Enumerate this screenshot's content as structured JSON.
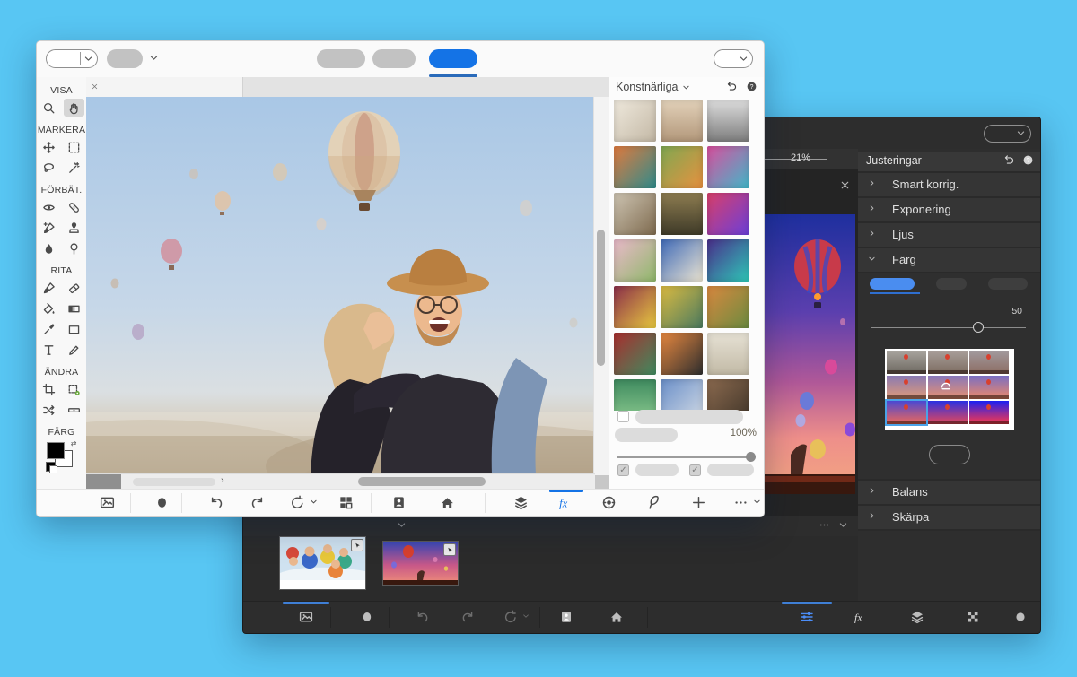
{
  "page": {
    "background_color": "#58c6f3",
    "accent_blue": "#1473e6",
    "dark_accent_blue": "#4b8df8"
  },
  "front_window": {
    "toolbar": {
      "left_controls": [
        {
          "name": "tool-preset-split-button"
        },
        {
          "name": "view-dropdown"
        }
      ],
      "mode_tabs": [
        {
          "name": "mode-tab-1",
          "active": false
        },
        {
          "name": "mode-tab-2",
          "active": false
        },
        {
          "name": "mode-tab-3",
          "active": true
        }
      ],
      "right_controls": [
        {
          "name": "open-dropdown"
        }
      ]
    },
    "sidebar": {
      "groups": [
        {
          "label": "VISA",
          "tools": [
            {
              "name": "zoom-tool",
              "icon": "zoom"
            },
            {
              "name": "hand-tool",
              "icon": "hand",
              "selected": true
            }
          ]
        },
        {
          "label": "MARKERA",
          "tools": [
            {
              "name": "move-tool",
              "icon": "move"
            },
            {
              "name": "marquee-tool",
              "icon": "marquee"
            },
            {
              "name": "lasso-tool",
              "icon": "lasso"
            },
            {
              "name": "magic-wand-tool",
              "icon": "magic-wand"
            }
          ]
        },
        {
          "label": "FÖRBÄT.",
          "tools": [
            {
              "name": "red-eye-tool",
              "icon": "red-eye"
            },
            {
              "name": "spot-heal-tool",
              "icon": "spot-heal"
            },
            {
              "name": "smart-brush-tool",
              "icon": "smart-brush"
            },
            {
              "name": "clone-stamp-tool",
              "icon": "clone-stamp"
            },
            {
              "name": "blur-tool",
              "icon": "blur"
            },
            {
              "name": "sponge-tool",
              "icon": "sponge"
            }
          ]
        },
        {
          "label": "RITA",
          "tools": [
            {
              "name": "brush-tool",
              "icon": "brush"
            },
            {
              "name": "eraser-tool",
              "icon": "eraser"
            },
            {
              "name": "paint-bucket-tool",
              "icon": "paint-bucket"
            },
            {
              "name": "gradient-tool",
              "icon": "gradient"
            },
            {
              "name": "eyedropper-tool",
              "icon": "eyedropper"
            },
            {
              "name": "shape-tool",
              "icon": "shape"
            },
            {
              "name": "type-tool",
              "icon": "type"
            },
            {
              "name": "pencil-tool",
              "icon": "pencil"
            }
          ]
        },
        {
          "label": "ÄNDRA",
          "tools": [
            {
              "name": "crop-tool",
              "icon": "crop"
            },
            {
              "name": "recompose-tool",
              "icon": "recompose"
            },
            {
              "name": "content-move-tool",
              "icon": "content-move"
            },
            {
              "name": "straighten-tool",
              "icon": "straighten"
            }
          ]
        },
        {
          "label": "FÄRG",
          "tools": [
            {
              "name": "color-swatches",
              "icon": "swatches"
            }
          ]
        }
      ]
    },
    "filters_panel": {
      "title": "Konstnärliga",
      "opacity_value": "100%",
      "thumbnails": [
        {
          "name": "portrait-sketch",
          "bg": "linear-gradient(135deg,#efe9dd,#c3b8a5)"
        },
        {
          "name": "taj-mahal-sepia",
          "bg": "linear-gradient(180deg,#e3d2ba,#b2977a)"
        },
        {
          "name": "city-mono",
          "bg": "linear-gradient(180deg,#dedede,#7d7d7d)"
        },
        {
          "name": "tropical-paint",
          "bg": "linear-gradient(135deg,#e07a3e,#2e8b8b)"
        },
        {
          "name": "gauguin-figures",
          "bg": "linear-gradient(135deg,#7fa851,#e8913f)"
        },
        {
          "name": "abstract-face",
          "bg": "linear-gradient(135deg,#d94f9e,#3fb8c9)"
        },
        {
          "name": "cubist-collage",
          "bg": "linear-gradient(135deg,#cdc4b2,#7e6a4e)"
        },
        {
          "name": "mona-lisa",
          "bg": "linear-gradient(180deg,#8d7c50,#3e3a28)"
        },
        {
          "name": "pop-portrait",
          "bg": "linear-gradient(135deg,#d93f6a,#6a3fd9)"
        },
        {
          "name": "pastel-village",
          "bg": "linear-gradient(135deg,#eab9ca,#8fb86a)"
        },
        {
          "name": "great-wave",
          "bg": "linear-gradient(135deg,#3f6ab8,#ece5d2)"
        },
        {
          "name": "abstract-teal",
          "bg": "linear-gradient(135deg,#4a2e8b,#2ec9b8)"
        },
        {
          "name": "pop-dog",
          "bg": "linear-gradient(135deg,#8b2e4a,#e8c93f)"
        },
        {
          "name": "van-gogh-portrait",
          "bg": "linear-gradient(135deg,#dcbb41,#4a7a5f)"
        },
        {
          "name": "olive-grove",
          "bg": "linear-gradient(135deg,#d9883f,#6a8b3f)"
        },
        {
          "name": "night-cafe",
          "bg": "linear-gradient(135deg,#a82e2e,#3f8b5f)"
        },
        {
          "name": "figure-abstract",
          "bg": "linear-gradient(135deg,#e8883f,#2e2e2e)"
        },
        {
          "name": "faint-sketch",
          "bg": "linear-gradient(180deg,#e6e1d4,#c2baa6)"
        },
        {
          "name": "green-feathers",
          "bg": "linear-gradient(180deg,#3f8b5f,#8bc98f)"
        },
        {
          "name": "starry-swirl",
          "bg": "linear-gradient(135deg,#6a8fc9,#d2dae4)"
        },
        {
          "name": "rustic-dark",
          "bg": "linear-gradient(135deg,#8b6a4f,#3f3428)"
        }
      ]
    },
    "bottombar": {
      "icons": [
        "photo-bin",
        "tool-options",
        "undo",
        "redo",
        "reset-rotate",
        "layout",
        "organizer",
        "home",
        "layers",
        "fx",
        "filters",
        "graphics",
        "add",
        "more"
      ],
      "active_icon": "fx"
    }
  },
  "back_window": {
    "zoom_value": "21%",
    "top_controls": [
      {
        "name": "open-dropdown"
      }
    ],
    "adjustments": {
      "title": "Justeringar",
      "sections": [
        {
          "label": "Smart korrig.",
          "expanded": false
        },
        {
          "label": "Exponering",
          "expanded": false
        },
        {
          "label": "Ljus",
          "expanded": false
        },
        {
          "label": "Färg",
          "expanded": true
        },
        {
          "label": "Balans",
          "expanded": false
        },
        {
          "label": "Skärpa",
          "expanded": false
        }
      ],
      "farg": {
        "tabs": [
          {
            "name": "farg-tab-1",
            "active": true
          },
          {
            "name": "farg-tab-2",
            "active": false
          },
          {
            "name": "farg-tab-3",
            "active": false
          }
        ],
        "value": "50",
        "selected_variation": 6,
        "overlay_variation": 4,
        "variations": [
          {
            "name": "variation-1",
            "bg": "linear-gradient(180deg,#a8a49e,#6c675f)"
          },
          {
            "name": "variation-2",
            "bg": "linear-gradient(180deg,#a89e9a,#7c6c60)"
          },
          {
            "name": "variation-3",
            "bg": "linear-gradient(180deg,#a29a9e,#8c6c62)"
          },
          {
            "name": "variation-4",
            "bg": "linear-gradient(180deg,#8a7ab2,#e09a78)"
          },
          {
            "name": "variation-5",
            "bg": "linear-gradient(180deg,#8878ba,#e89070)"
          },
          {
            "name": "variation-6",
            "bg": "linear-gradient(180deg,#7a6ec2,#ee8868)"
          },
          {
            "name": "variation-7",
            "bg": "linear-gradient(180deg,#4a48d2,#f06858)"
          },
          {
            "name": "variation-8",
            "bg": "linear-gradient(180deg,#2a30e2,#e84858)"
          },
          {
            "name": "variation-9",
            "bg": "linear-gradient(180deg,#1a20f2,#ff3848)"
          }
        ]
      }
    },
    "photo_bin": {
      "thumbnails": [
        {
          "name": "group-selfie"
        },
        {
          "name": "balloon-sunset"
        }
      ]
    },
    "bottombar": {
      "icons": [
        "photo-bin",
        "tool-options",
        "undo",
        "redo",
        "reset-rotate",
        "organizer",
        "home",
        "adjustments",
        "effects",
        "layers",
        "texture",
        "graphics-circle"
      ],
      "active_icons": [
        "photo-bin",
        "adjustments"
      ]
    }
  }
}
